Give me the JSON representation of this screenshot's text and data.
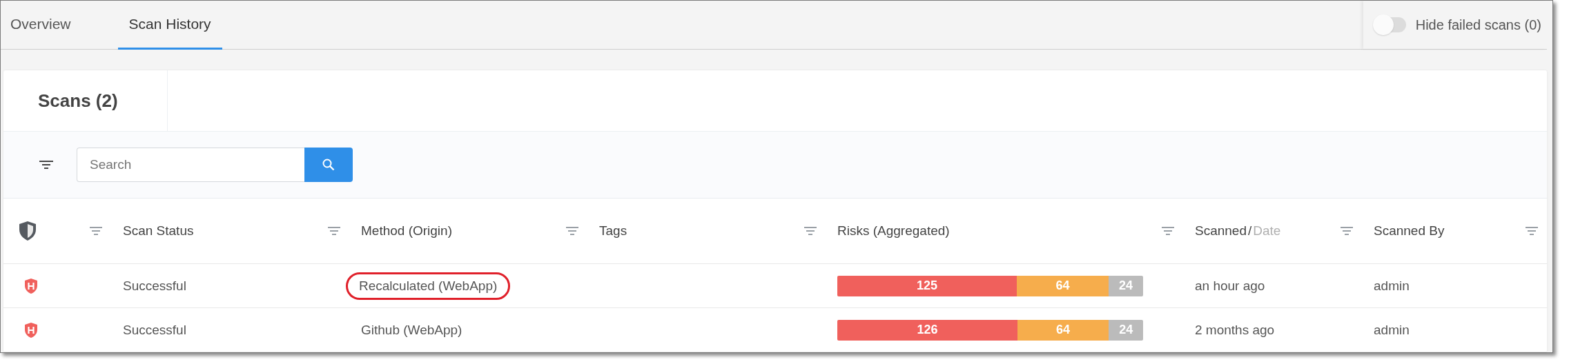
{
  "tabs": [
    {
      "label": "Overview",
      "selected": false
    },
    {
      "label": "Scan History",
      "selected": true
    }
  ],
  "hide_failed_toggle": {
    "label": "Hide failed scans (0)",
    "on": false
  },
  "card": {
    "title": "Scans (2)"
  },
  "search": {
    "placeholder": "Search"
  },
  "columns": [
    {
      "kind": "icon"
    },
    {
      "kind": "text",
      "label": "Scan Status"
    },
    {
      "kind": "text",
      "label": "Method (Origin)"
    },
    {
      "kind": "text",
      "label": "Tags"
    },
    {
      "kind": "text",
      "label": "Risks (Aggregated)"
    },
    {
      "kind": "split",
      "label": "Scanned",
      "separator": "/",
      "secondary": "Date"
    },
    {
      "kind": "text",
      "label": "Scanned By"
    }
  ],
  "rows": [
    {
      "status": "Successful",
      "method": "Recalculated (WebApp)",
      "circled": true,
      "risks": [
        {
          "value": "125",
          "color": "#f0605c"
        },
        {
          "value": "64",
          "color": "#f6ad4c"
        },
        {
          "value": "24",
          "color": "#bbbbbb"
        }
      ],
      "scanned": "an hour ago",
      "scanned_by": "admin"
    },
    {
      "status": "Successful",
      "method": "Github (WebApp)",
      "circled": false,
      "risks": [
        {
          "value": "126",
          "color": "#f0605c"
        },
        {
          "value": "64",
          "color": "#f6ad4c"
        },
        {
          "value": "24",
          "color": "#bbbbbb"
        }
      ],
      "scanned": "2 months ago",
      "scanned_by": "admin"
    }
  ]
}
